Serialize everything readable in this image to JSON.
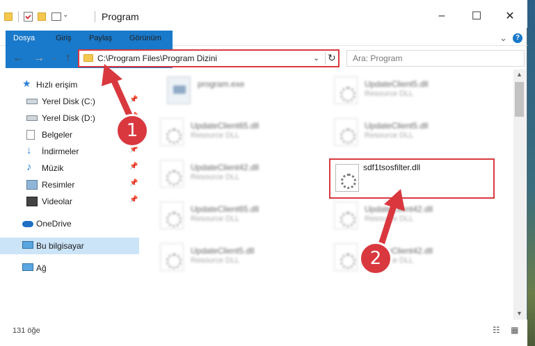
{
  "window": {
    "title": "Program",
    "controls": {
      "minimize": "–",
      "maximize": "☐",
      "close": "✕"
    }
  },
  "ribbon": {
    "tabs": [
      "Dosya",
      "Giriş",
      "Paylaş",
      "Görünüm"
    ],
    "collapse": "⌄",
    "help": "?"
  },
  "nav": {
    "back": "←",
    "forward": "→",
    "up": "↑"
  },
  "address": {
    "path": "C:\\Program Files\\Program Dizini",
    "dropdown": "⌄",
    "refresh": "↻"
  },
  "search": {
    "placeholder": "Ara: Program"
  },
  "sidebar": {
    "quick_access": "Hızlı erişim",
    "items": [
      {
        "label": "Yerel Disk (C:)",
        "pin": "📌"
      },
      {
        "label": "Yerel Disk (D:)",
        "pin": "📌"
      },
      {
        "label": "Belgeler",
        "pin": "📌"
      },
      {
        "label": "İndirmeler",
        "pin": "📌"
      },
      {
        "label": "Müzik",
        "pin": "📌"
      },
      {
        "label": "Resimler",
        "pin": "📌"
      },
      {
        "label": "Videolar",
        "pin": "📌"
      }
    ],
    "onedrive": "OneDrive",
    "this_pc": "Bu bilgisayar",
    "network": "Ağ"
  },
  "files": [
    {
      "name": "program.exe",
      "type": ""
    },
    {
      "name": "UpdateClient5.dll",
      "type": "Resource DLL"
    },
    {
      "name": "UpdateClient65.dll",
      "type": "Resource DLL"
    },
    {
      "name": "UpdateClient5.dll",
      "type": "Resource DLL"
    },
    {
      "name": "UpdateClient42.dll",
      "type": "Resource DLL"
    },
    {
      "name": "UpdateClient65.dll",
      "type": "Resource DLL"
    },
    {
      "name": "UpdateClient42.dll",
      "type": "Resource DLL"
    },
    {
      "name": "UpdateClient5.dll",
      "type": "Resource DLL"
    },
    {
      "name": "UpdateClient42.dll",
      "type": "Resource DLL"
    }
  ],
  "highlighted_file": {
    "name": "sdf1tsosfilter.dll"
  },
  "status": {
    "count": "131 öğe",
    "views": "☷ ▦"
  },
  "annotations": {
    "step1": "1",
    "step2": "2"
  },
  "colors": {
    "accent": "#1979ca",
    "annotation": "#d9383f",
    "selected": "#cce4f7"
  }
}
